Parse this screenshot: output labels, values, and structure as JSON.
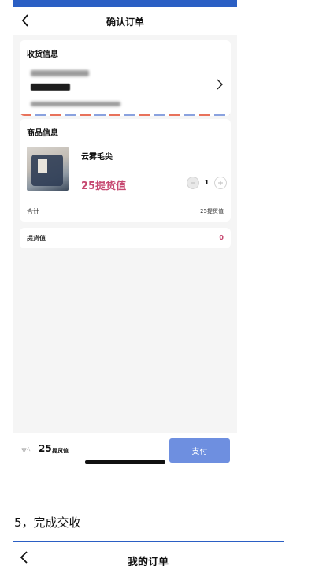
{
  "header": {
    "title": "确认订单"
  },
  "address": {
    "section_title": "收货信息"
  },
  "goods": {
    "section_title": "商品信息",
    "name": "云雾毛尖",
    "price": "25提货值",
    "quantity": "1",
    "total_label": "合计",
    "total_value": "25提货值"
  },
  "points": {
    "label": "提货值",
    "value": "0"
  },
  "footer": {
    "pay_label": "支付",
    "pay_amount": "25",
    "pay_unit": "提货值",
    "pay_button": "支付"
  },
  "doc": {
    "step_text": "5，完成交收"
  },
  "next_screen": {
    "title": "我的订单"
  },
  "colors": {
    "accent": "#2b5fc4",
    "price": "#c64870",
    "pay_button": "#6e8fe0"
  },
  "icons": {
    "back": "chevron-left-icon",
    "arrow": "chevron-right-icon"
  }
}
